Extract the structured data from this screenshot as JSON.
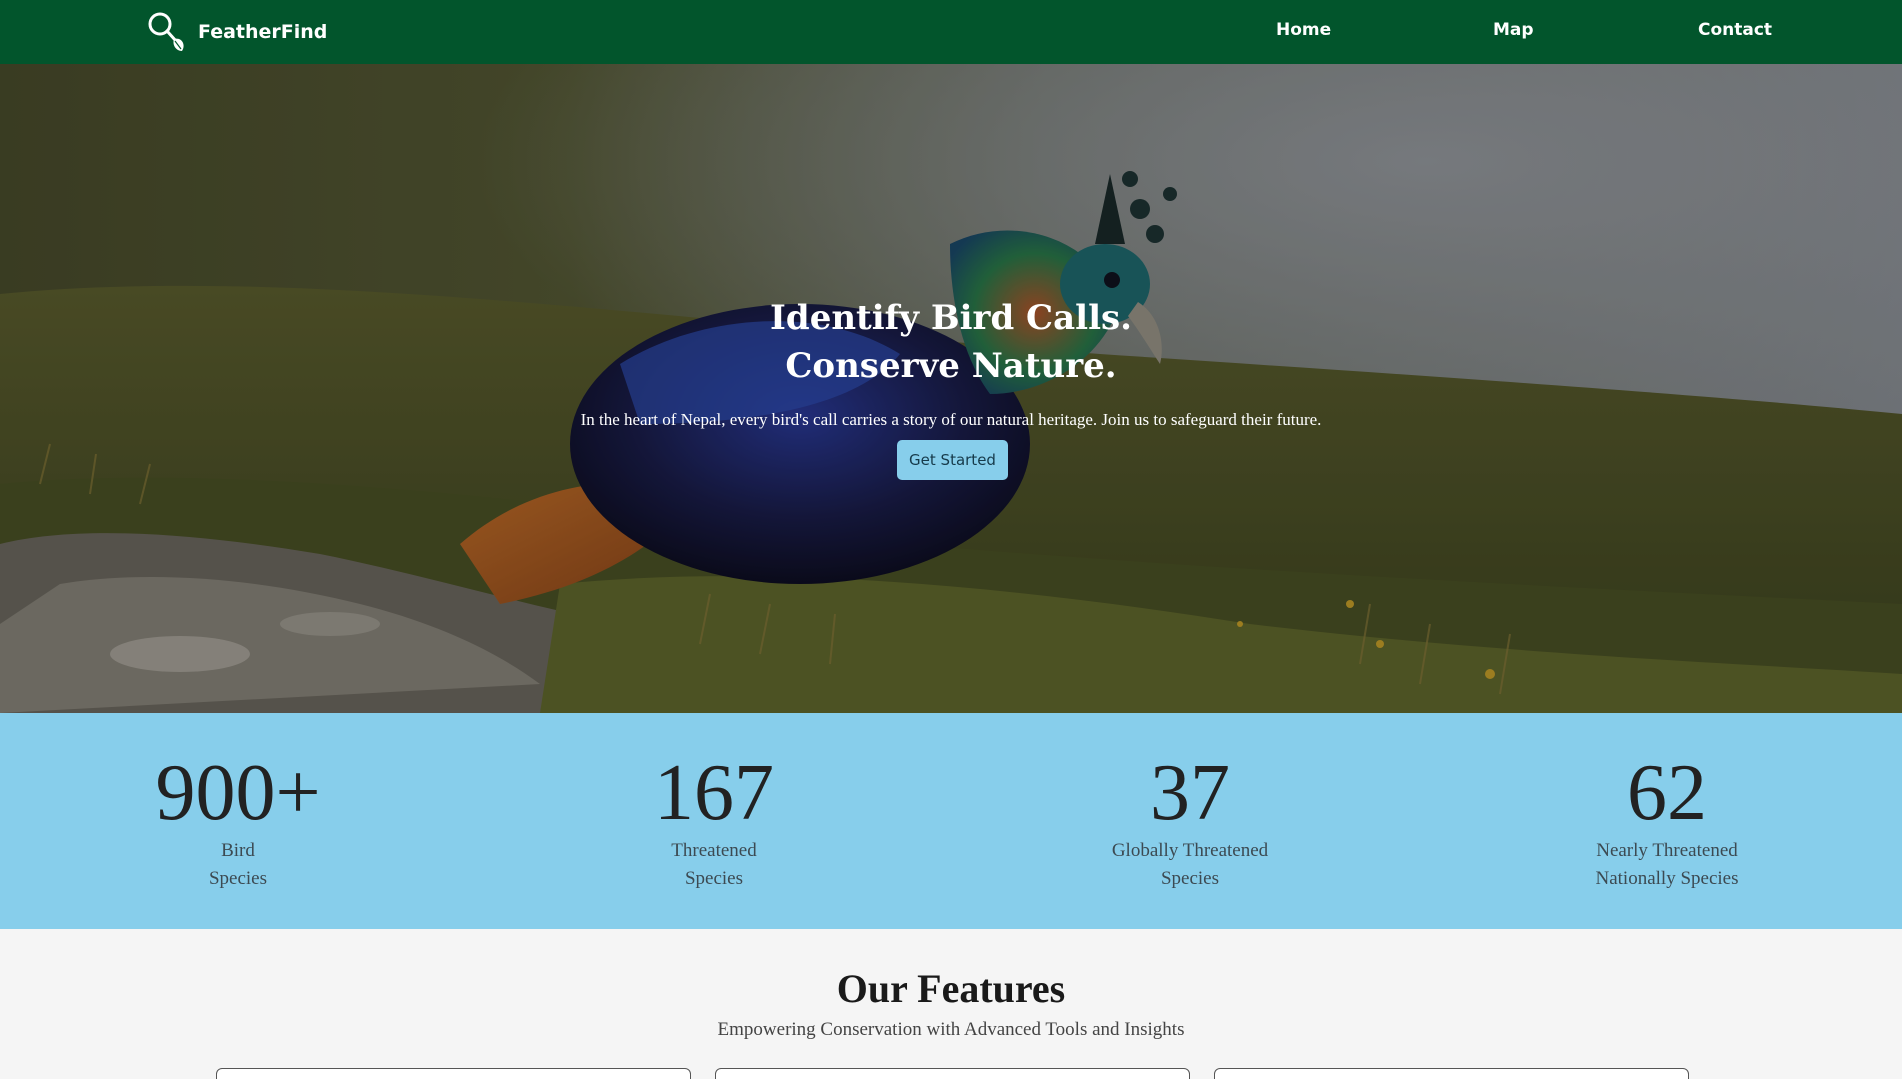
{
  "nav": {
    "brand": "FeatherFind",
    "links": [
      "Home",
      "Map",
      "Contact"
    ]
  },
  "hero": {
    "title_line1": "Identify Bird Calls.",
    "title_line2": "Conserve Nature.",
    "subtitle": "In the heart of Nepal, every bird's call carries a story of our natural heritage. Join us to safeguard their future.",
    "button": "Get Started"
  },
  "stats": [
    {
      "value": "900+",
      "line1": "Bird",
      "line2": "Species"
    },
    {
      "value": "167",
      "line1": "Threatened",
      "line2": "Species"
    },
    {
      "value": "37",
      "line1": "Globally Threatened",
      "line2": "Species"
    },
    {
      "value": "62",
      "line1": "Nearly Threatened",
      "line2": "Nationally Species"
    }
  ],
  "features": {
    "title": "Our Features",
    "subtitle": "Empowering Conservation with Advanced Tools and Insights"
  },
  "colors": {
    "nav_bg": "#02552c",
    "accent": "#87ceeb",
    "page_bg": "#f5f5f5"
  }
}
